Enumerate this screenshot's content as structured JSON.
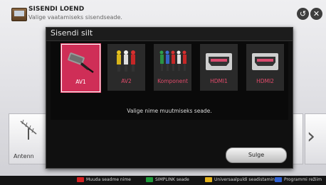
{
  "header": {
    "title": "SISENDI LOEND",
    "subtitle": "Valige vaatamiseks sisendseade."
  },
  "controls": {
    "back_icon": "back-icon",
    "close_icon": "close-icon"
  },
  "background": {
    "antenna_label": "Antenn"
  },
  "dialog": {
    "title": "Sisendi silt",
    "items": [
      {
        "label": "AV1",
        "icon": "scart-plug-icon",
        "selected": true
      },
      {
        "label": "AV2",
        "icon": "rca-plug-icon",
        "selected": false
      },
      {
        "label": "Komponent",
        "icon": "component-plug-icon",
        "selected": false
      },
      {
        "label": "HDMI1",
        "icon": "hdmi-port-icon",
        "selected": false
      },
      {
        "label": "HDMI2",
        "icon": "hdmi-port-icon",
        "selected": false
      }
    ],
    "hint": "Valige nime muutmiseks seade.",
    "close_label": "Sulge"
  },
  "footer": {
    "items": [
      {
        "label": "Muuda seadme nime",
        "color": "#d42020"
      },
      {
        "label": "SIMPLINK seade",
        "color": "#1e9a3a"
      },
      {
        "label": "Universaalpuldi seadistamine",
        "color": "#e3b11b"
      },
      {
        "label": "Programmi režiim",
        "color": "#2e5fd0"
      }
    ]
  },
  "colors": {
    "accent": "#cf2e57",
    "label_inactive": "#e24b6b"
  }
}
